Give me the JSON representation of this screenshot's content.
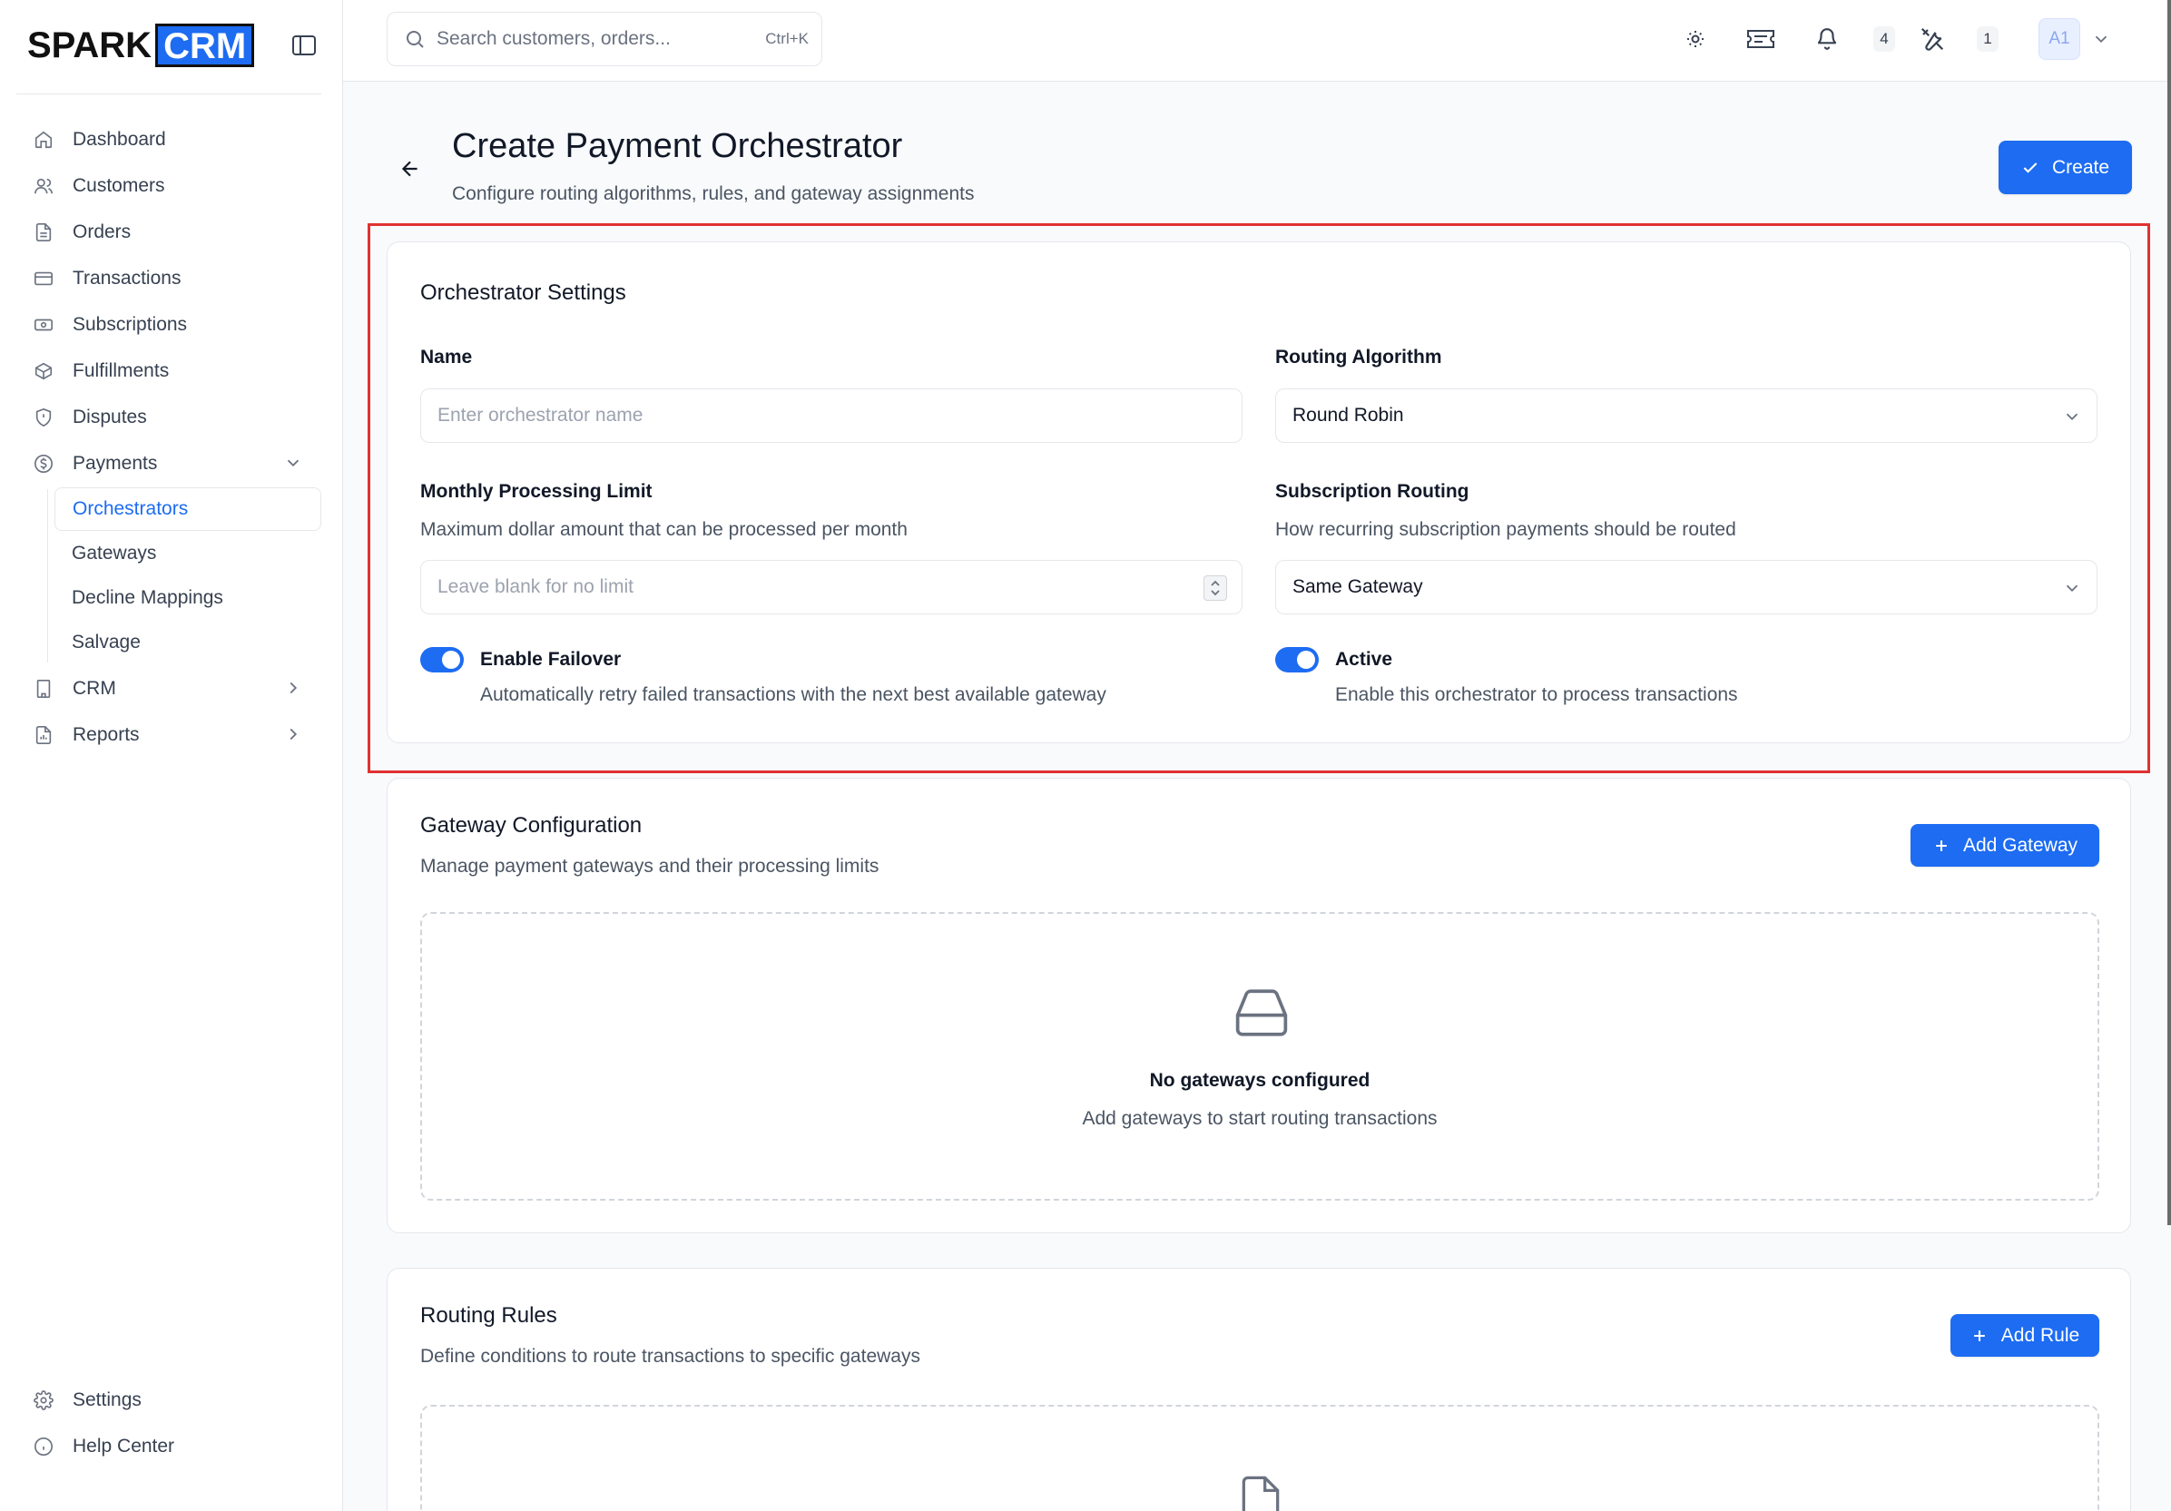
{
  "brand": {
    "part1": "SPARK",
    "part2": "CRM"
  },
  "sidebar": {
    "items": [
      {
        "label": "Dashboard",
        "icon": "home-icon"
      },
      {
        "label": "Customers",
        "icon": "users-icon"
      },
      {
        "label": "Orders",
        "icon": "file-icon"
      },
      {
        "label": "Transactions",
        "icon": "credit-card-icon"
      },
      {
        "label": "Subscriptions",
        "icon": "banknote-icon"
      },
      {
        "label": "Fulfillments",
        "icon": "package-icon"
      },
      {
        "label": "Disputes",
        "icon": "shield-icon"
      },
      {
        "label": "Payments",
        "icon": "dollar-circle-icon",
        "expanded": true
      }
    ],
    "payments_sub": [
      {
        "label": "Orchestrators",
        "active": true
      },
      {
        "label": "Gateways"
      },
      {
        "label": "Decline Mappings"
      },
      {
        "label": "Salvage"
      }
    ],
    "items_after": [
      {
        "label": "CRM",
        "icon": "building-icon"
      },
      {
        "label": "Reports",
        "icon": "report-icon"
      }
    ],
    "bottom": [
      {
        "label": "Settings",
        "icon": "gear-icon"
      },
      {
        "label": "Help Center",
        "icon": "info-icon"
      }
    ]
  },
  "topbar": {
    "search_placeholder": "Search customers, orders...",
    "search_shortcut": "Ctrl+K",
    "notifications_count": "4",
    "tools_count": "1",
    "avatar_initials": "A1"
  },
  "header": {
    "title": "Create Payment Orchestrator",
    "subtitle": "Configure routing algorithms, rules, and gateway assignments",
    "create_label": "Create"
  },
  "settings": {
    "title": "Orchestrator Settings",
    "name_label": "Name",
    "name_placeholder": "Enter orchestrator name",
    "routing_label": "Routing Algorithm",
    "routing_value": "Round Robin",
    "limit_label": "Monthly Processing Limit",
    "limit_help": "Maximum dollar amount that can be processed per month",
    "limit_placeholder": "Leave blank for no limit",
    "sub_routing_label": "Subscription Routing",
    "sub_routing_help": "How recurring subscription payments should be routed",
    "sub_routing_value": "Same Gateway",
    "failover_label": "Enable Failover",
    "failover_help": "Automatically retry failed transactions with the next best available gateway",
    "failover_on": true,
    "active_label": "Active",
    "active_help": "Enable this orchestrator to process transactions",
    "active_on": true
  },
  "gateways": {
    "title": "Gateway Configuration",
    "desc": "Manage payment gateways and their processing limits",
    "add_label": "Add Gateway",
    "empty_title": "No gateways configured",
    "empty_desc": "Add gateways to start routing transactions"
  },
  "rules": {
    "title": "Routing Rules",
    "desc": "Define conditions to route transactions to specific gateways",
    "add_label": "Add Rule"
  },
  "colors": {
    "accent": "#1d6cf2",
    "highlight": "#e03131"
  }
}
